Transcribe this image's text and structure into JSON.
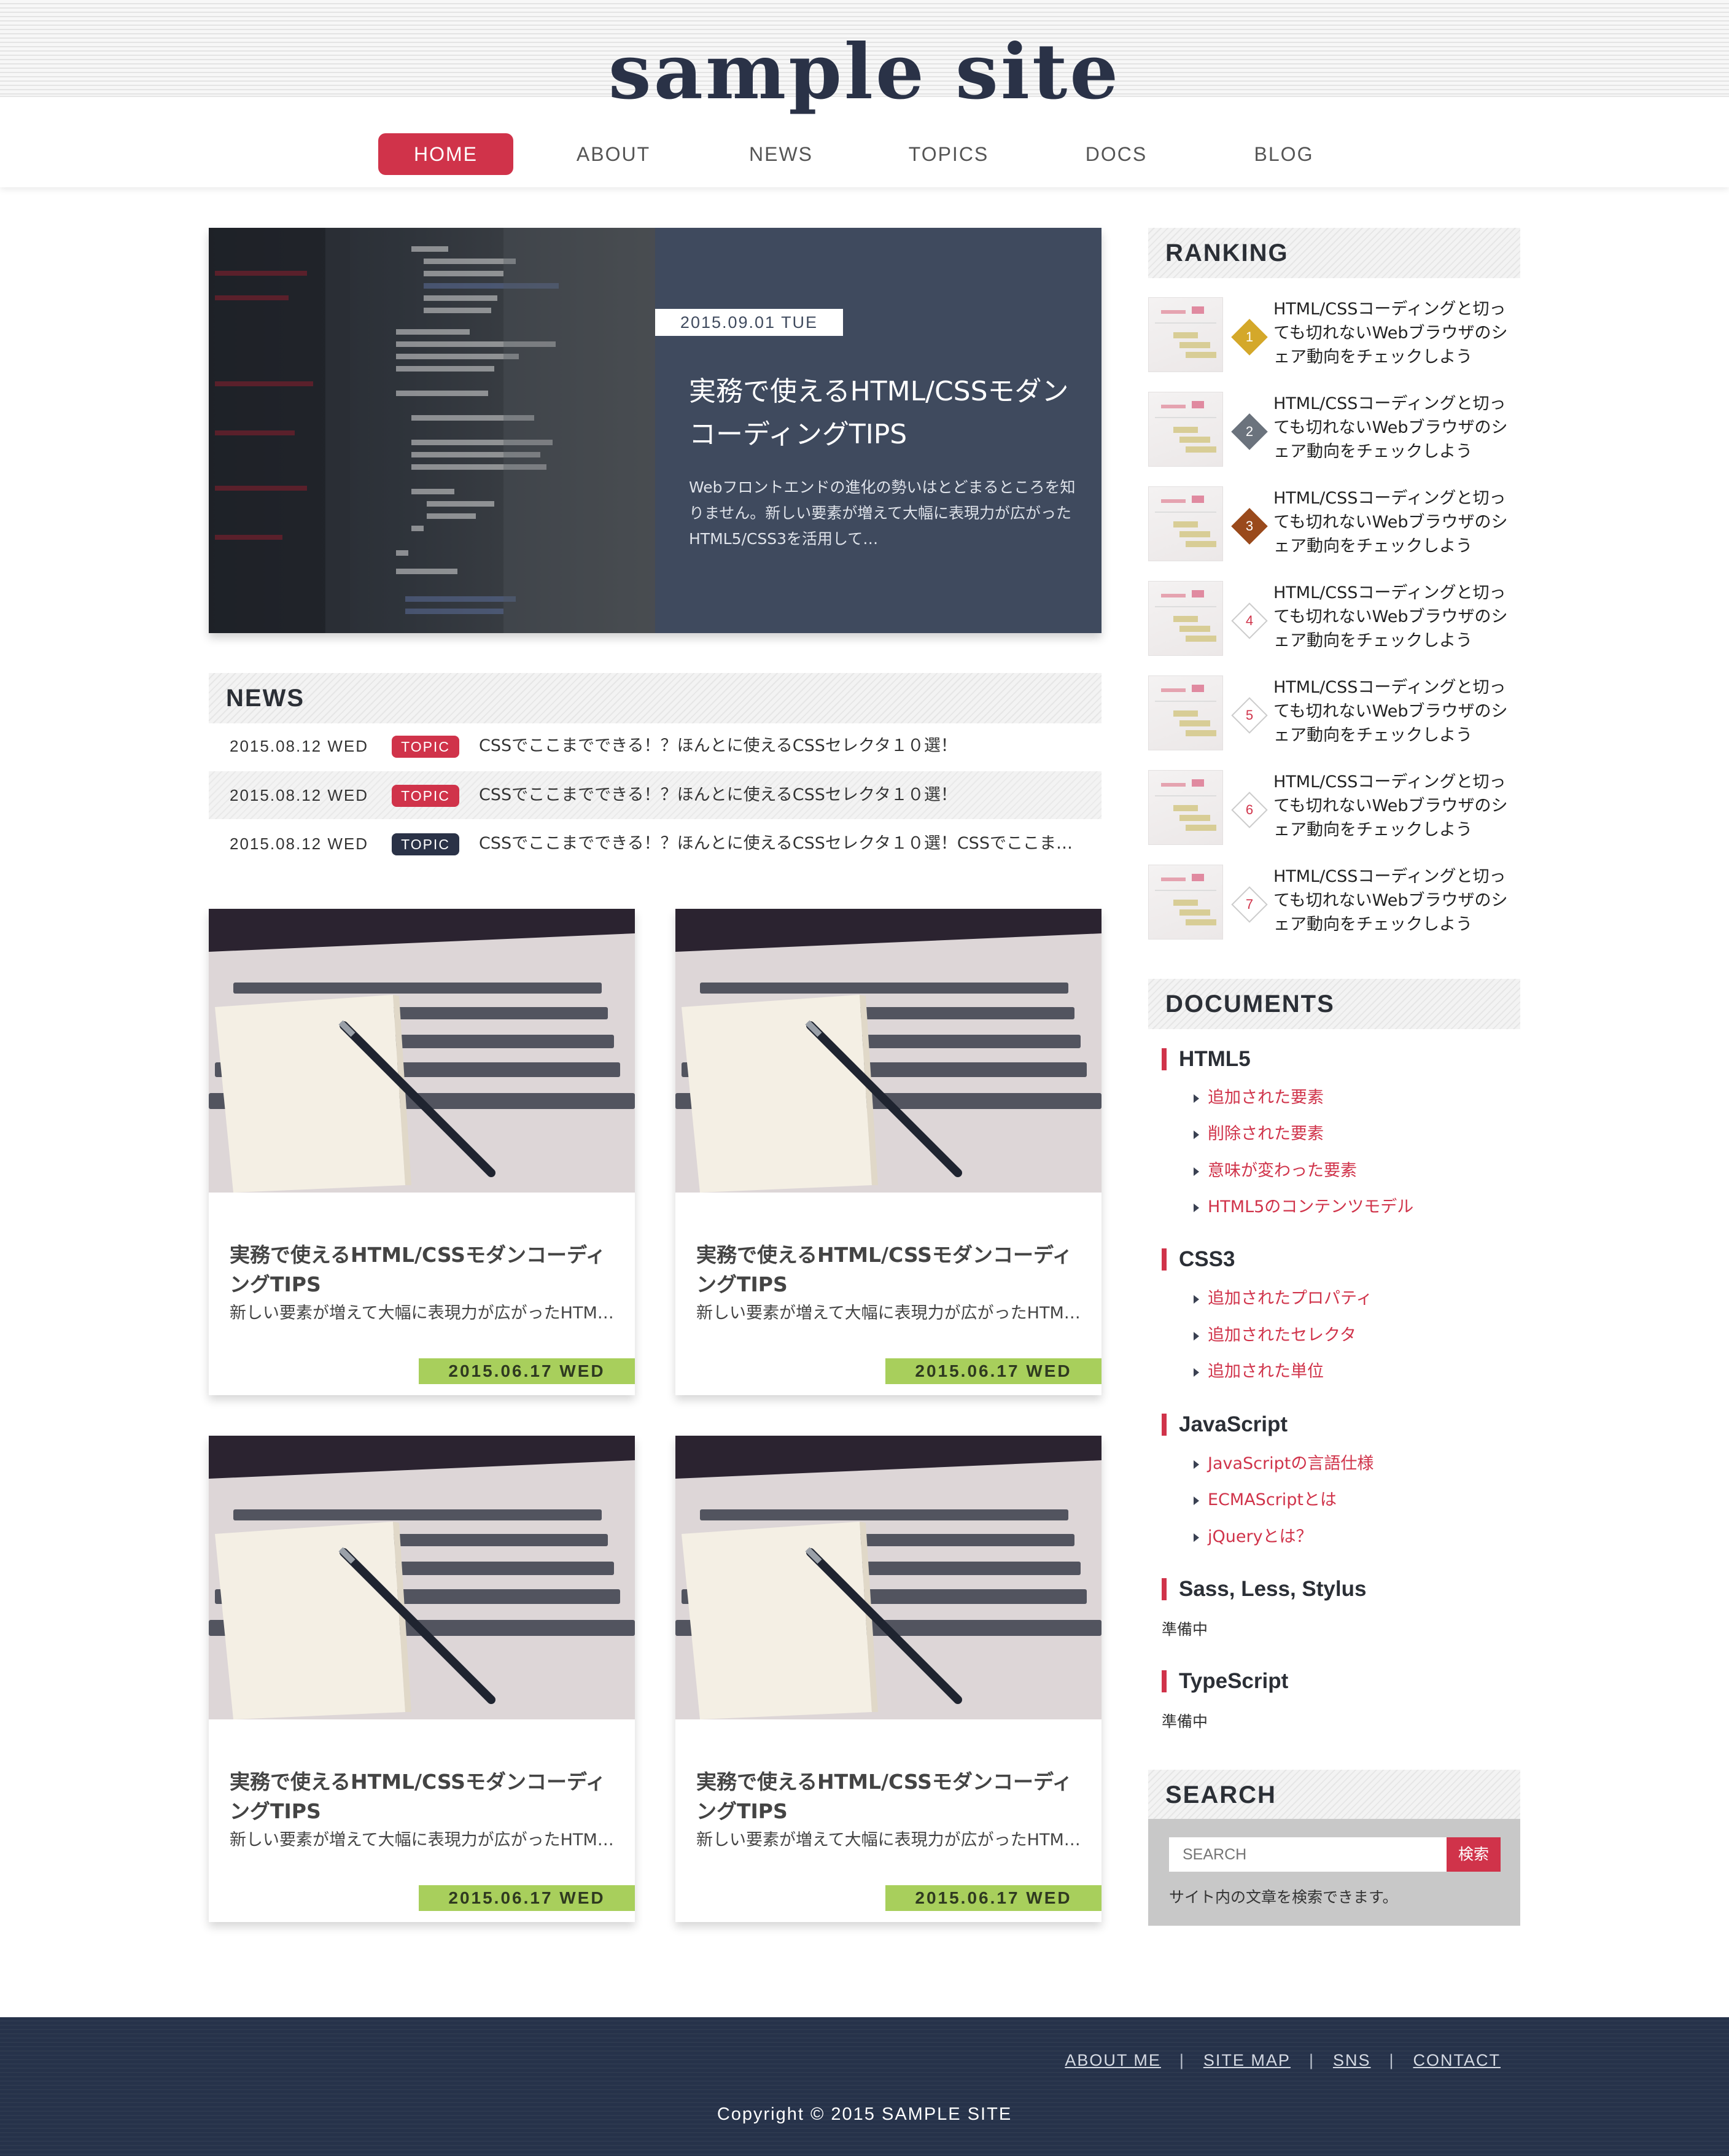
{
  "site": {
    "logo": "sample site"
  },
  "nav": {
    "items": [
      {
        "label": "HOME",
        "active": true
      },
      {
        "label": "ABOUT",
        "active": false
      },
      {
        "label": "NEWS",
        "active": false
      },
      {
        "label": "TOPICS",
        "active": false
      },
      {
        "label": "DOCS",
        "active": false
      },
      {
        "label": "BLOG",
        "active": false
      }
    ]
  },
  "hero": {
    "date": "2015.09.01 TUE",
    "title": "実務で使えるHTML/CSSモダンコーディングTIPS",
    "text": "Webフロントエンドの進化の勢いはとどまるところを知りません。新しい要素が増えて大幅に表現力が広がったHTML5/CSS3を活用して…"
  },
  "news": {
    "heading": "NEWS",
    "items": [
      {
        "date": "2015.08.12 WED",
        "badge": "TOPIC",
        "badge_color": "#d0334a",
        "text": "CSSでここまでできる！？ほんとに使えるCSSセレクタ１０選！"
      },
      {
        "date": "2015.08.12 WED",
        "badge": "TOPIC",
        "badge_color": "#d0334a",
        "text": "CSSでここまでできる！？ほんとに使えるCSSセレクタ１０選！"
      },
      {
        "date": "2015.08.12 WED",
        "badge": "TOPIC",
        "badge_color": "#2a3247",
        "text": "CSSでここまでできる！？ほんとに使えるCSSセレクタ１０選！CSSでここま…"
      }
    ]
  },
  "cards": [
    {
      "title": "実務で使えるHTML/CSSモダンコーディングTIPS",
      "text": "新しい要素が増えて大幅に表現力が広がったHTM…",
      "date": "2015.06.17 WED"
    },
    {
      "title": "実務で使えるHTML/CSSモダンコーディングTIPS",
      "text": "新しい要素が増えて大幅に表現力が広がったHTM…",
      "date": "2015.06.17 WED"
    },
    {
      "title": "実務で使えるHTML/CSSモダンコーディングTIPS",
      "text": "新しい要素が増えて大幅に表現力が広がったHTM…",
      "date": "2015.06.17 WED"
    },
    {
      "title": "実務で使えるHTML/CSSモダンコーディングTIPS",
      "text": "新しい要素が増えて大幅に表現力が広がったHTM…",
      "date": "2015.06.17 WED"
    }
  ],
  "ranking": {
    "heading": "RANKING",
    "items": [
      {
        "rank": "1",
        "text": "HTML/CSSコーディングと切っても切れないWebブラウザのシェア動向をチェックしよう",
        "color": "#d4a82a"
      },
      {
        "rank": "2",
        "text": "HTML/CSSコーディングと切っても切れないWebブラウザのシェア動向をチェックしよう",
        "color": "#6b737d"
      },
      {
        "rank": "3",
        "text": "HTML/CSSコーディングと切っても切れないWebブラウザのシェア動向をチェックしよう",
        "color": "#9a4a1c"
      },
      {
        "rank": "4",
        "text": "HTML/CSSコーディングと切っても切れないWebブラウザのシェア動向をチェックしよう",
        "color": "#ffffff"
      },
      {
        "rank": "5",
        "text": "HTML/CSSコーディングと切っても切れないWebブラウザのシェア動向をチェックしよう",
        "color": "#ffffff"
      },
      {
        "rank": "6",
        "text": "HTML/CSSコーディングと切っても切れないWebブラウザのシェア動向をチェックしよう",
        "color": "#ffffff"
      },
      {
        "rank": "7",
        "text": "HTML/CSSコーディングと切っても切れないWebブラウザのシェア動向をチェックしよう",
        "color": "#ffffff"
      }
    ]
  },
  "documents": {
    "heading": "DOCUMENTS",
    "html5": {
      "title": "HTML5",
      "links": [
        "追加された要素",
        "削除された要素",
        "意味が変わった要素",
        "HTML5のコンテンツモデル"
      ]
    },
    "css3": {
      "title": "CSS3",
      "links": [
        "追加されたプロパティ",
        "追加されたセレクタ",
        "追加された単位"
      ]
    },
    "javascript": {
      "title": "JavaScript",
      "links": [
        "JavaScriptの言語仕様",
        "ECMAScriptとは",
        "jQueryとは？"
      ]
    },
    "sass": {
      "title": "Sass, Less, Stylus",
      "note": "準備中"
    },
    "typescript": {
      "title": "TypeScript",
      "note": "準備中"
    }
  },
  "search": {
    "heading": "SEARCH",
    "placeholder": "SEARCH",
    "button": "検索",
    "note": "サイト内の文章を検索できます。"
  },
  "footer": {
    "links": [
      "ABOUT ME",
      "SITE MAP",
      "SNS",
      "CONTACT"
    ],
    "copyright": "Copyright © 2015 SAMPLE SITE"
  },
  "colors": {
    "accent": "#d0334a",
    "navy": "#2a3247",
    "hero_panel": "#3f4a5e",
    "date_green": "#a8cf5c"
  }
}
